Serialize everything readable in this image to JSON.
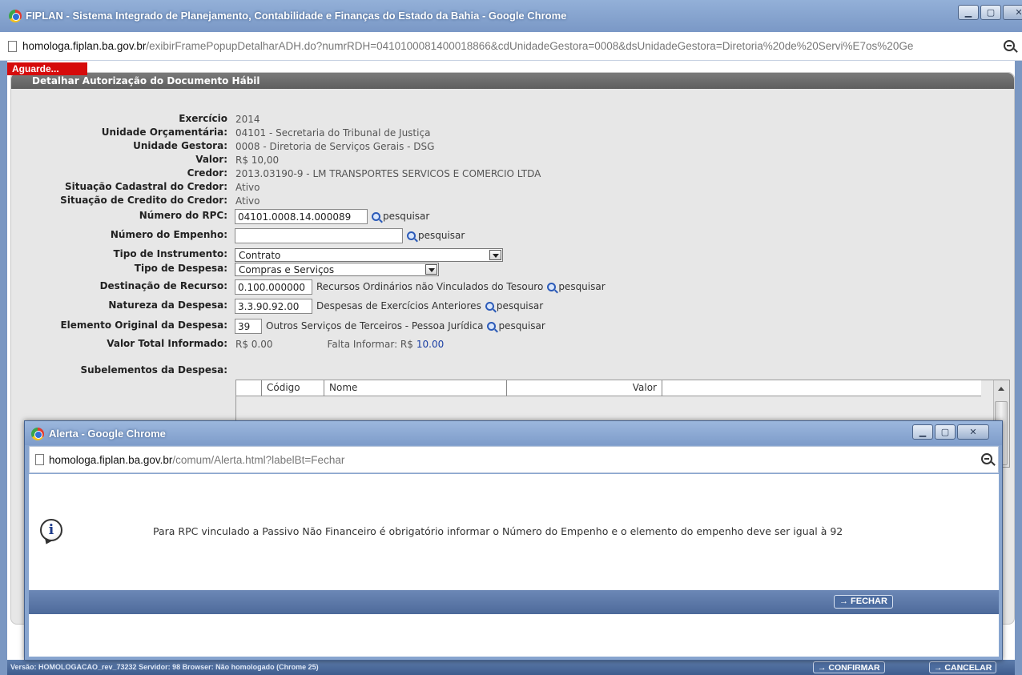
{
  "window": {
    "title": "FIPLAN - Sistema Integrado de Planejamento, Contabilidade e Finanças do Estado da Bahia - Google Chrome",
    "url_host": "homologa.fiplan.ba.gov.br",
    "url_path": "/exibirFramePopupDetalharADH.do?numrRDH=0410100081400018866&cdUnidadeGestora=0008&dsUnidadeGestora=Diretoria%20de%20Servi%E7os%20Ge"
  },
  "page": {
    "aguarde": "Aguarde...",
    "panel_title": "Detalhar Autorização do Documento Hábil"
  },
  "form": {
    "exercicio": {
      "label": "Exercício",
      "value": "2014"
    },
    "unidade_orcamentaria": {
      "label": "Unidade Orçamentária:",
      "value": "04101 - Secretaria do Tribunal de Justiça"
    },
    "unidade_gestora": {
      "label": "Unidade Gestora:",
      "value": "0008 - Diretoria de Serviços Gerais - DSG"
    },
    "valor": {
      "label": "Valor:",
      "value": "R$ 10,00"
    },
    "credor": {
      "label": "Credor:",
      "value": "2013.03190-9 - LM TRANSPORTES SERVICOS E COMERCIO LTDA"
    },
    "situacao_cadastral": {
      "label": "Situação Cadastral do Credor:",
      "value": "Ativo"
    },
    "situacao_credito": {
      "label": "Situação de Credito do Credor:",
      "value": "Ativo"
    },
    "numero_rpc": {
      "label": "Número do RPC:",
      "value": "04101.0008.14.000089"
    },
    "numero_empenho": {
      "label": "Número do Empenho:",
      "value": ""
    },
    "tipo_instrumento": {
      "label": "Tipo de Instrumento:",
      "value": "Contrato"
    },
    "tipo_despesa": {
      "label": "Tipo de Despesa:",
      "value": "Compras e Serviços"
    },
    "destinacao_recurso": {
      "label": "Destinação de Recurso:",
      "value": "0.100.000000",
      "desc": "Recursos Ordinários não Vinculados do Tesouro"
    },
    "natureza_despesa": {
      "label": "Natureza da Despesa:",
      "value": "3.3.90.92.00",
      "desc": "Despesas de Exercícios Anteriores"
    },
    "elemento_original": {
      "label": "Elemento Original da Despesa:",
      "value": "39",
      "desc": "Outros Serviços de Terceiros - Pessoa Jurídica"
    },
    "valor_total": {
      "label": "Valor Total Informado:",
      "value": "R$ 0.00",
      "falta_label": "Falta Informar: R$",
      "falta_value": "10.00"
    },
    "subelementos": {
      "label": "Subelementos da Despesa:"
    },
    "search_label": "pesquisar"
  },
  "grid": {
    "columns": [
      "",
      "Código",
      "Nome",
      "Valor"
    ]
  },
  "status": {
    "text": "Versão: HOMOLOGACAO_rev_73232  Servidor: 98  Browser: Não homologado (Chrome 25)",
    "confirmar": "→ CONFIRMAR",
    "cancelar": "→ CANCELAR"
  },
  "modal": {
    "title": "Alerta - Google Chrome",
    "url_host": "homologa.fiplan.ba.gov.br",
    "url_path": "/comum/Alerta.html?labelBt=Fechar",
    "message": "Para RPC vinculado a Passivo Não Financeiro é obrigatório informar o Número do Empenho e o elemento do empenho deve ser igual à 92",
    "button": "→ FECHAR"
  }
}
